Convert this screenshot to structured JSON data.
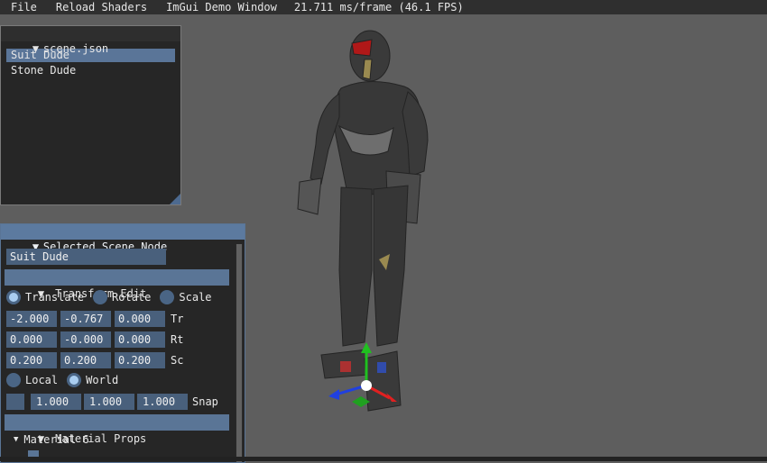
{
  "menubar": {
    "file": "File",
    "reload": "Reload Shaders",
    "demo": "ImGui Demo Window",
    "stats": "21.711 ms/frame (46.1 FPS)"
  },
  "scene_panel": {
    "title": "scene.json",
    "items": [
      "Suit Dude",
      "Stone Dude"
    ]
  },
  "node_panel": {
    "title": "Selected Scene Node",
    "name_value": "Suit Dude",
    "transform_header": "Transform Edit",
    "modes": [
      "Translate",
      "Rotate",
      "Scale"
    ],
    "selected_mode": "Translate",
    "translate": [
      "-2.000",
      "-0.767",
      "0.000"
    ],
    "translate_label": "Tr",
    "rotate": [
      "0.000",
      "-0.000",
      "0.000"
    ],
    "rotate_label": "Rt",
    "scale": [
      "0.200",
      "0.200",
      "0.200"
    ],
    "scale_label": "Sc",
    "space_local": "Local",
    "space_world": "World",
    "selected_space": "World",
    "snap": [
      "1.000",
      "1.000",
      "1.000"
    ],
    "snap_label": "Snap",
    "material_header": "Material Props",
    "material_item": "Material 6"
  },
  "icons": [
    "collapse-triangle-icon",
    "tree-arrow-icon",
    "resize-grip-icon",
    "gizmo-icon"
  ],
  "colors": {
    "accent": "#5a7596",
    "selection": "#5a7598",
    "field": "#49607c",
    "gizmo_x": "#e02020",
    "gizmo_y": "#20c020",
    "gizmo_z": "#2040e0"
  }
}
